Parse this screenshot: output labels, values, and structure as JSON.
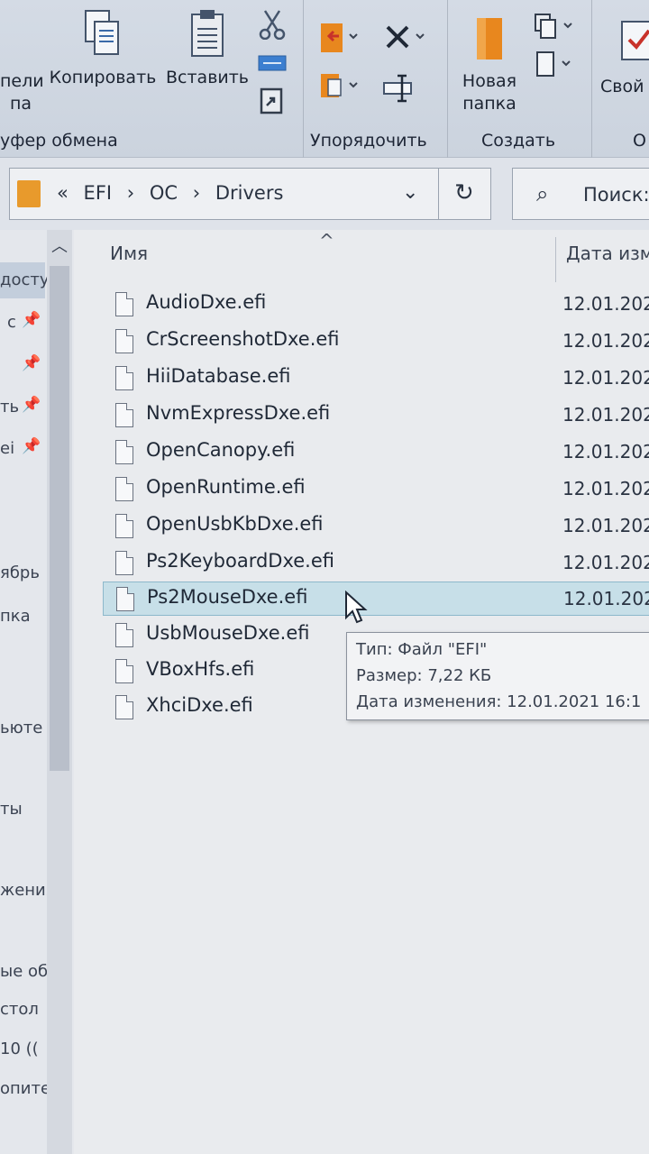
{
  "ribbon": {
    "clipboard_group": {
      "pin_label_partial": "пели",
      "pin_label_2_partial": "па",
      "copy_label": "Копировать",
      "paste_label": "Вставить",
      "group_label": "уфер обмена"
    },
    "organize_group": {
      "group_label": "Упорядочить"
    },
    "new_group": {
      "new_folder_line1": "Новая",
      "new_folder_line2": "папка",
      "group_label": "Создать"
    },
    "open_group": {
      "props_label_partial": "Свой",
      "group_label_partial": "О"
    }
  },
  "address": {
    "overflow": "«",
    "crumbs": [
      "EFI",
      "OC",
      "Drivers"
    ],
    "search_placeholder": "Поиск:"
  },
  "nav": {
    "items": [
      {
        "label": "досту",
        "selected": true
      },
      {
        "label": "с",
        "pinned": true
      },
      {
        "label": "",
        "pinned": true
      },
      {
        "label": "ть",
        "pinned": true
      },
      {
        "label": "еі",
        "pinned": true
      },
      {
        "label": "ябрь"
      },
      {
        "label": "пка"
      },
      {
        "label": "ьюте"
      },
      {
        "label": "ты"
      },
      {
        "label": "жения"
      },
      {
        "label": "ые об"
      },
      {
        "label": "стол"
      },
      {
        "label": "10 (("
      },
      {
        "label": "опите"
      }
    ]
  },
  "list": {
    "col_name": "Имя",
    "col_date": "Дата изм",
    "files": [
      {
        "name": "AudioDxe.efi",
        "date": "12.01.202"
      },
      {
        "name": "CrScreenshotDxe.efi",
        "date": "12.01.202"
      },
      {
        "name": "HiiDatabase.efi",
        "date": "12.01.202"
      },
      {
        "name": "NvmExpressDxe.efi",
        "date": "12.01.202"
      },
      {
        "name": "OpenCanopy.efi",
        "date": "12.01.202"
      },
      {
        "name": "OpenRuntime.efi",
        "date": "12.01.202"
      },
      {
        "name": "OpenUsbKbDxe.efi",
        "date": "12.01.202"
      },
      {
        "name": "Ps2KeyboardDxe.efi",
        "date": "12.01.202"
      },
      {
        "name": "Ps2MouseDxe.efi",
        "date": "12.01.202",
        "selected": true
      },
      {
        "name": "UsbMouseDxe.efi",
        "date": ""
      },
      {
        "name": "VBoxHfs.efi",
        "date": ""
      },
      {
        "name": "XhciDxe.efi",
        "date": ""
      }
    ]
  },
  "tooltip": {
    "type": "Тип: Файл \"EFI\"",
    "size": "Размер: 7,22 КБ",
    "modified": "Дата изменения: 12.01.2021 16:1"
  },
  "colors": {
    "selection": "#c7dfe8",
    "folder": "#e89a2c",
    "accent_red": "#c8322a"
  }
}
